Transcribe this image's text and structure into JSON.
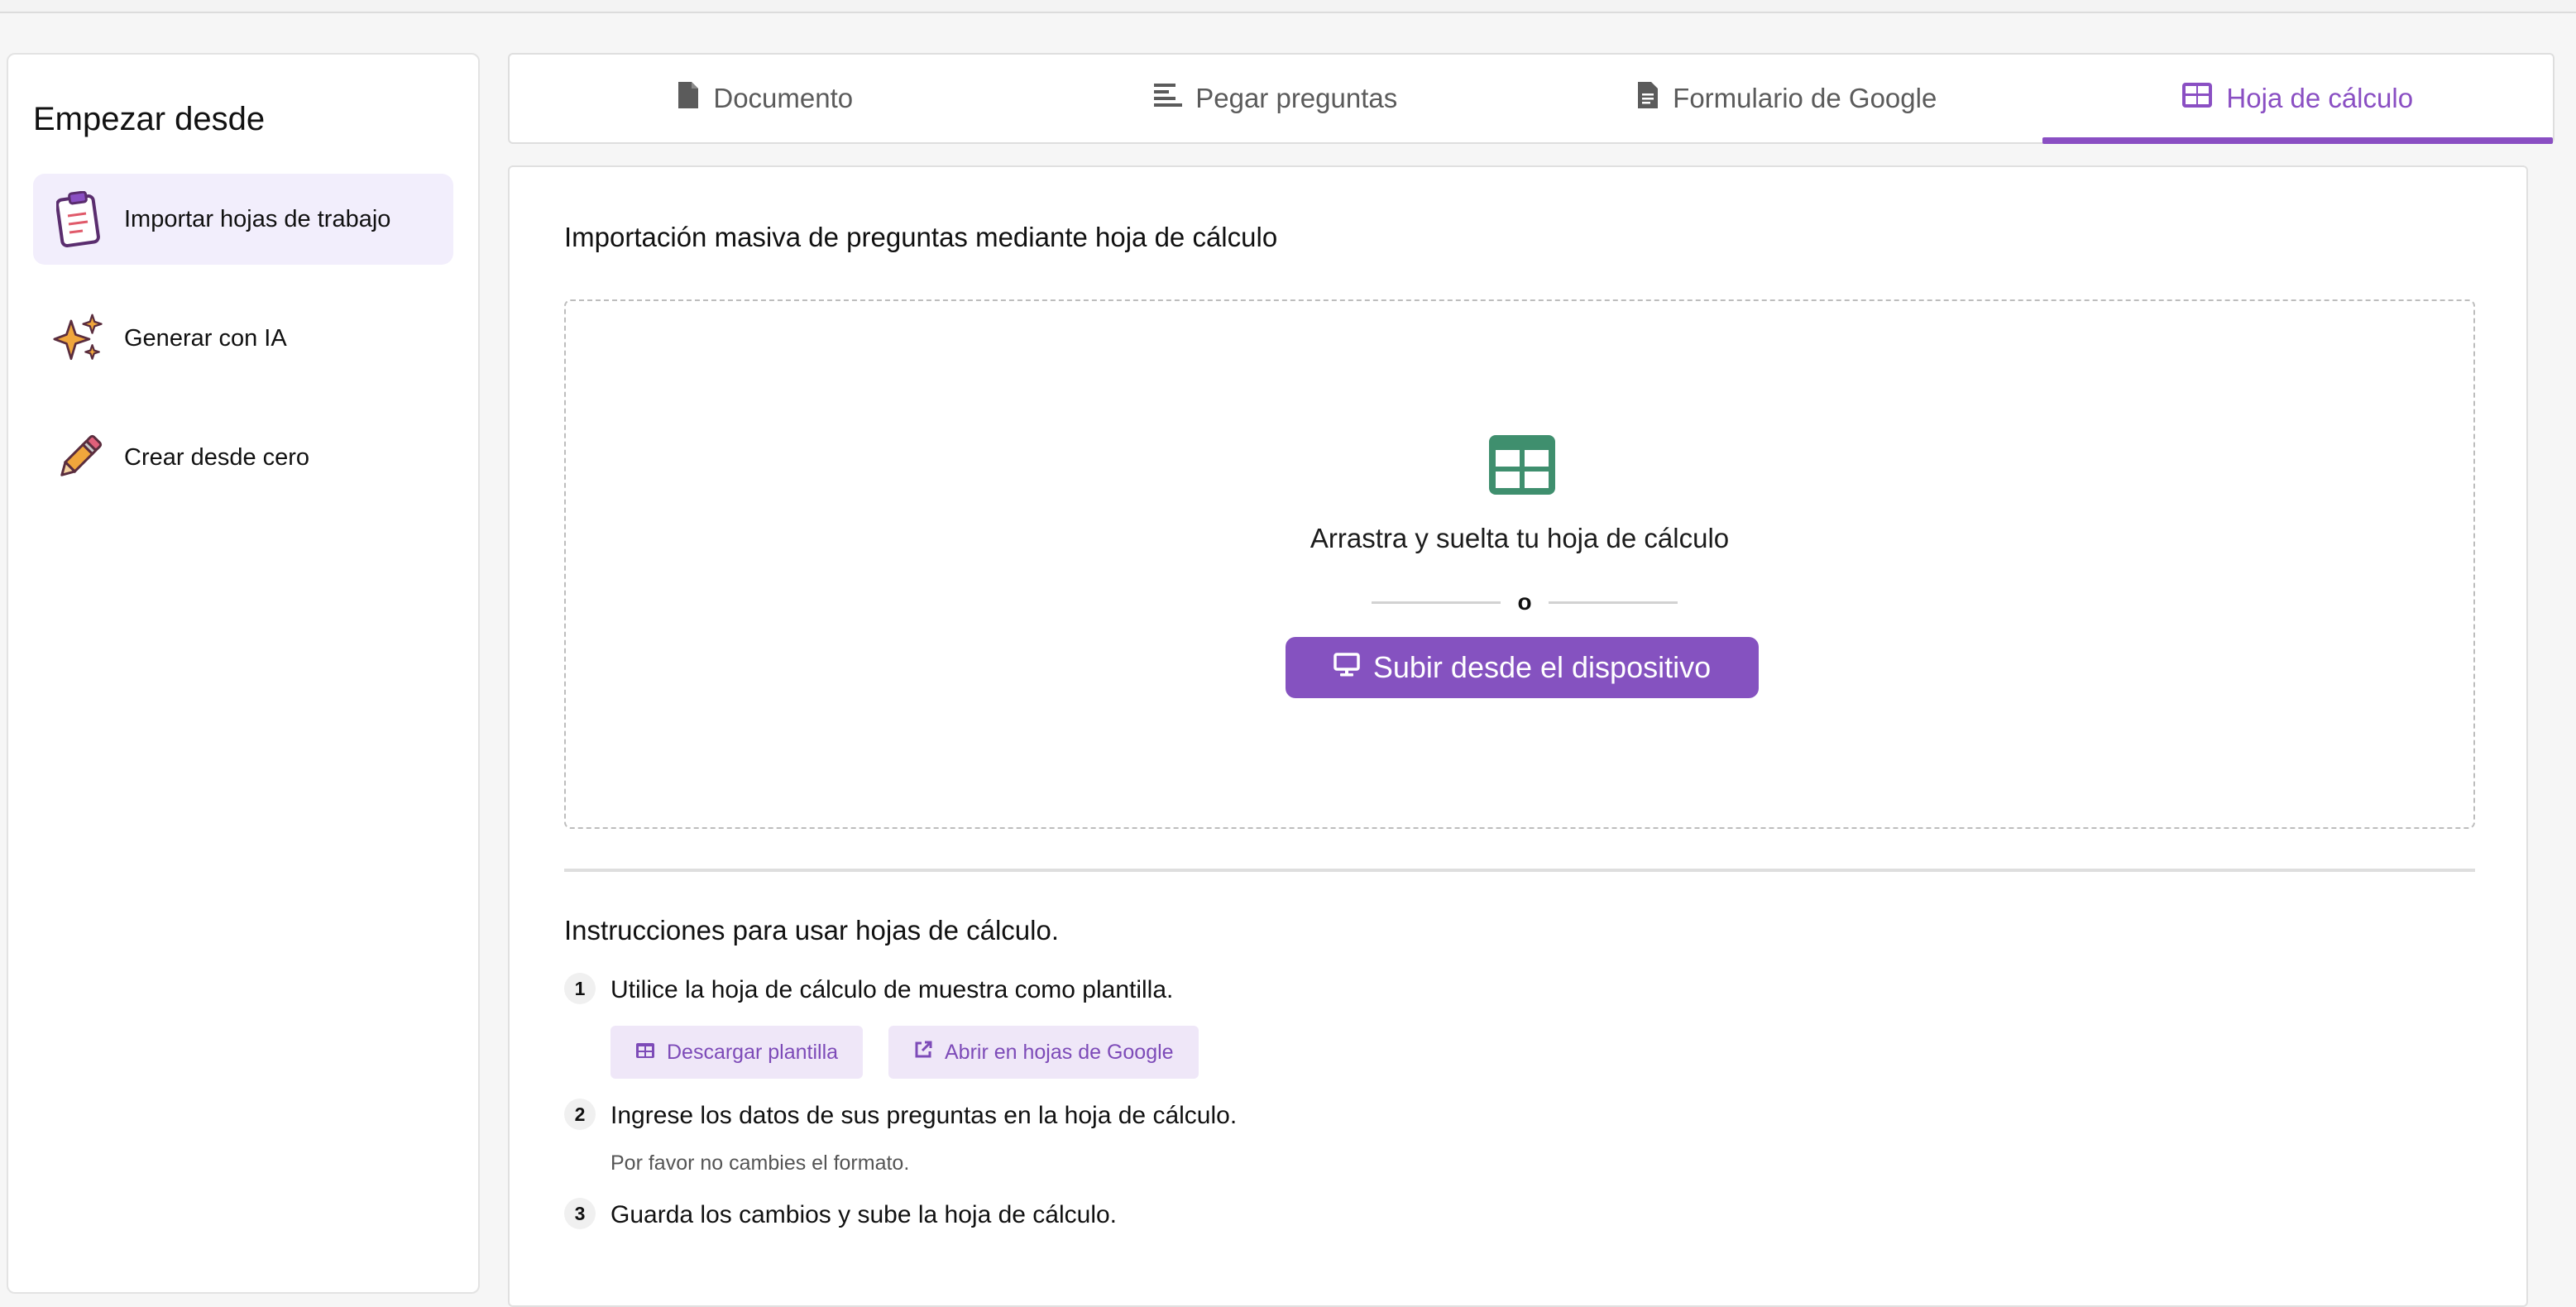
{
  "sidebar": {
    "heading": "Empezar desde",
    "items": [
      {
        "label": "Importar hojas de trabajo",
        "icon": "clipboard-icon",
        "active": true
      },
      {
        "label": "Generar con IA",
        "icon": "sparkles-icon",
        "active": false
      },
      {
        "label": "Crear desde cero",
        "icon": "pencil-icon",
        "active": false
      }
    ]
  },
  "tabs": [
    {
      "label": "Documento",
      "icon": "file-icon"
    },
    {
      "label": "Pegar preguntas",
      "icon": "text-lines-icon"
    },
    {
      "label": "Formulario de Google",
      "icon": "google-form-icon"
    },
    {
      "label": "Hoja de cálculo",
      "icon": "spreadsheet-icon",
      "active": true
    }
  ],
  "main": {
    "title": "Importación masiva de preguntas mediante hoja de cálculo",
    "dropzone": {
      "text": "Arrastra y suelta tu hoja de cálculo",
      "or": "o",
      "upload_button": "Subir desde el dispositivo"
    },
    "instructions": {
      "title": "Instrucciones para usar hojas de cálculo.",
      "steps": [
        {
          "num": "1",
          "text": "Utilice la hoja de cálculo de muestra como plantilla."
        },
        {
          "num": "2",
          "text": "Ingrese los datos de sus preguntas en la hoja de cálculo.",
          "note": "Por favor no cambies el formato."
        },
        {
          "num": "3",
          "text": "Guarda los cambios y sube la hoja de cálculo."
        }
      ],
      "download_template": "Descargar plantilla",
      "open_google_sheets": "Abrir en hojas de Google"
    }
  },
  "colors": {
    "accent": "#8552c0",
    "accent_light": "#efe7f8",
    "spreadsheet_green": "#3f8f6e"
  }
}
